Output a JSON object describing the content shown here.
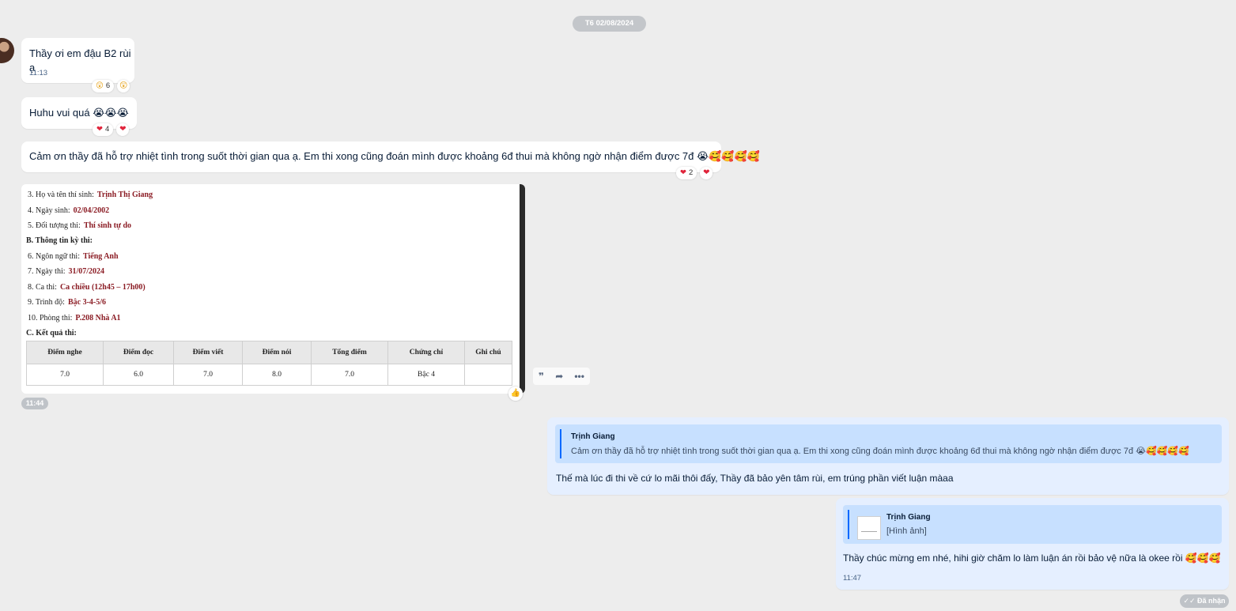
{
  "date_separator": "T6 02/08/2024",
  "messages": {
    "m1": {
      "text": "Thầy ơi em đậu B2 rùi ạ",
      "time": "11:13",
      "reaction_icon": "😲",
      "reaction_count": "6",
      "reaction_mine": "😲"
    },
    "m2": {
      "text": "Huhu vui quá 😭😭😭",
      "reaction_icon": "❤",
      "reaction_count": "4",
      "reaction_mine": "❤"
    },
    "m3": {
      "text": "Cảm ơn thầy đã hỗ trợ nhiệt tình trong suốt thời gian qua ạ. Em thi xong cũng đoán mình được khoảng 6đ thui mà không ngờ nhận điểm được 7đ 😭🥰🥰🥰🥰",
      "reaction_icon": "❤",
      "reaction_count": "2",
      "reaction_mine": "❤"
    }
  },
  "image_card": {
    "rows": [
      {
        "label": "3. Họ và tên thí sinh:",
        "value": "Trịnh Thị Giang"
      },
      {
        "label": "4. Ngày sinh:",
        "value": "02/04/2002"
      },
      {
        "label": "5. Đối tượng thi:",
        "value": "Thí sinh tự do"
      },
      {
        "label": "B. Thông tin kỳ thi:",
        "value": ""
      },
      {
        "label": "6. Ngôn ngữ thi:",
        "value": "Tiếng Anh"
      },
      {
        "label": "7. Ngày thi:",
        "value": "31/07/2024"
      },
      {
        "label": "8. Ca thi:",
        "value": "Ca chiều (12h45 – 17h00)"
      },
      {
        "label": "9. Trình độ:",
        "value": "Bậc 3-4-5/6"
      },
      {
        "label": "10. Phòng thi:",
        "value": "P.208 Nhà A1"
      }
    ],
    "section_c": "C. Kết quả thi:",
    "table_headers": [
      "Điểm nghe",
      "Điểm đọc",
      "Điểm viết",
      "Điểm nói",
      "Tổng điểm",
      "Chứng chỉ",
      "Ghi chú"
    ],
    "table_values": [
      "7.0",
      "6.0",
      "7.0",
      "8.0",
      "7.0",
      "Bậc 4",
      ""
    ],
    "time": "11:44"
  },
  "actions": {
    "quote_icon": "quote-icon",
    "share_icon": "share-icon",
    "more_icon": "more-icon",
    "like_icon": "like-icon"
  },
  "reply1": {
    "quote_name": "Trịnh Giang",
    "quote_text": "Cảm ơn thầy đã hỗ trợ nhiệt tình trong suốt thời gian qua ạ. Em thi xong cũng đoán mình được khoảng 6đ thui mà không ngờ nhận điểm được 7đ 😭🥰🥰🥰🥰",
    "text": "Thế mà lúc đi thi về cứ lo mãi thôi đấy, Thầy đã bảo yên tâm rùi, em trúng phần viết luận màaa"
  },
  "reply2": {
    "quote_name": "Trịnh Giang",
    "quote_text": "[Hình ảnh]",
    "text": "Thầy chúc mừng em nhé, hihi giờ chăm lo làm luận án rồi bảo vệ nữa là okee rồi 🥰🥰🥰",
    "time": "11:47"
  },
  "status": "Đã nhận"
}
